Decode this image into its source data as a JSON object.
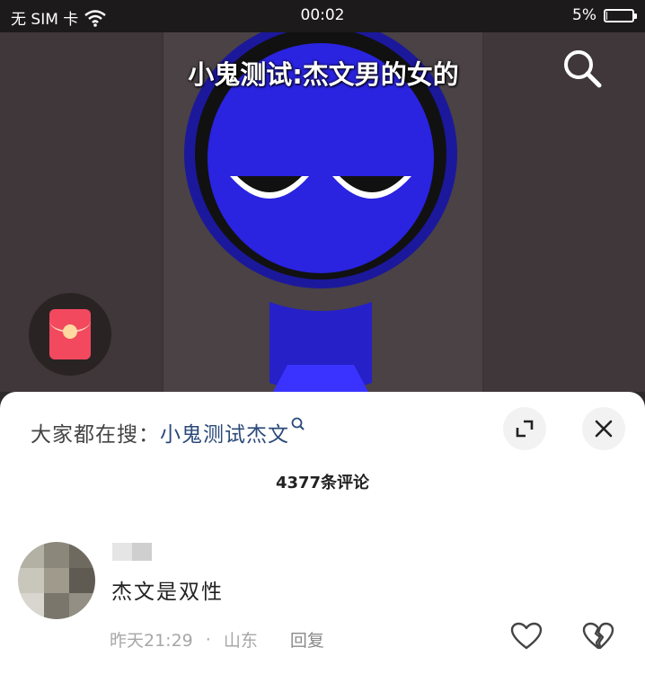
{
  "status_bar": {
    "carrier": "无 SIM 卡",
    "time": "00:02",
    "battery_text": "5%",
    "battery_level": 0.05
  },
  "video": {
    "title": "小鬼测试:杰文男的女的",
    "icons": [
      "search-icon",
      "red-packet-icon",
      "wifi-icon"
    ]
  },
  "comments_sheet": {
    "trending_prefix": "大家都在搜：",
    "trending_term": "小鬼测试杰文",
    "count_label": "4377条评论",
    "comments": [
      {
        "text": "杰文是双性",
        "time": "昨天21:29",
        "location": "山东",
        "separator": "·",
        "reply_label": "回复"
      }
    ]
  },
  "colors": {
    "accent_link": "#2b4a7a",
    "red_packet": "#f2495e",
    "figure_blue": "#2a23e0"
  }
}
